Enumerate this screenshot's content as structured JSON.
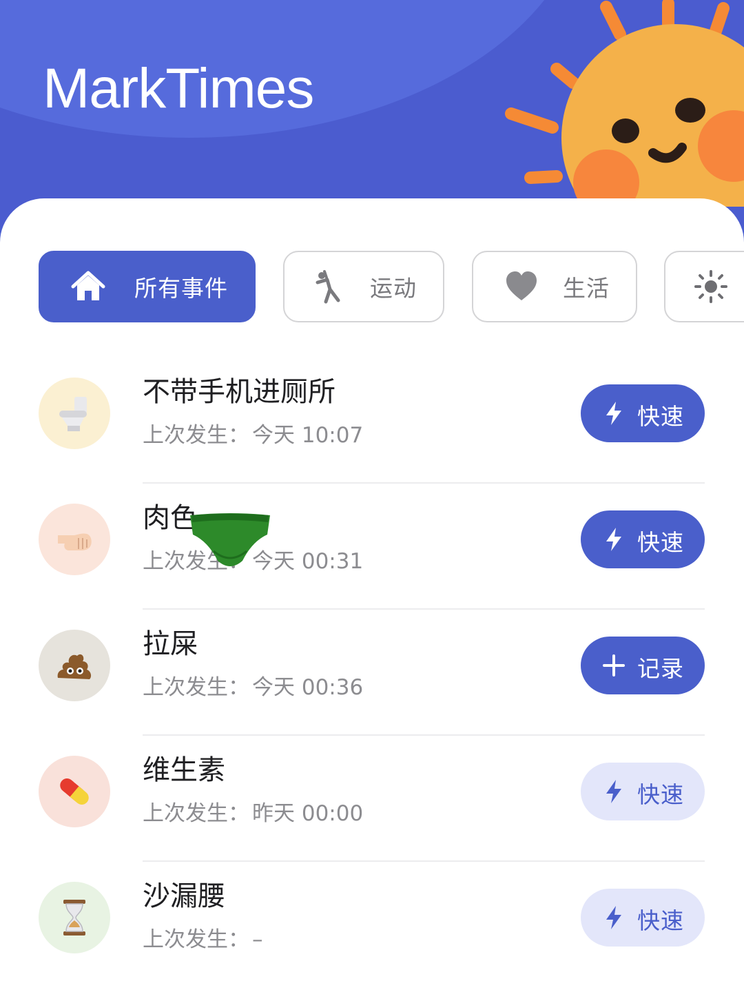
{
  "app": {
    "title": "MarkTimes"
  },
  "colors": {
    "primary": "#4a5fcb",
    "header": "#4b5ccf",
    "button_light": "#e3e6fa",
    "text": "#1f1f22",
    "subtext": "#8c8c90"
  },
  "tabs": [
    {
      "label": "所有事件",
      "icon": "home-icon",
      "active": true
    },
    {
      "label": "运动",
      "icon": "stretch-icon",
      "active": false
    },
    {
      "label": "生活",
      "icon": "heart-icon",
      "active": false
    },
    {
      "label": "",
      "icon": "sun-icon",
      "active": false
    }
  ],
  "events": [
    {
      "title": "不带手机进厕所",
      "sub_label": "上次发生：",
      "sub_value": "今天 10:07",
      "icon": "toilet-icon",
      "action": {
        "label": "快速",
        "icon": "lightning-icon",
        "style": "solid"
      }
    },
    {
      "title": "肉色",
      "sub_label": "上次发生：",
      "sub_value": "今天 00:31",
      "icon": "fist-icon",
      "action": {
        "label": "快速",
        "icon": "lightning-icon",
        "style": "solid"
      }
    },
    {
      "title": "拉屎",
      "sub_label": "上次发生：",
      "sub_value": "今天 00:36",
      "icon": "poop-icon",
      "action": {
        "label": "记录",
        "icon": "plus-icon",
        "style": "solid"
      }
    },
    {
      "title": "维生素",
      "sub_label": "上次发生：",
      "sub_value": "昨天 00:00",
      "icon": "pill-icon",
      "action": {
        "label": "快速",
        "icon": "lightning-icon",
        "style": "light"
      }
    },
    {
      "title": "沙漏腰",
      "sub_label": "上次发生：",
      "sub_value": "–",
      "icon": "hourglass-icon",
      "action": {
        "label": "快速",
        "icon": "lightning-icon",
        "style": "light"
      }
    }
  ]
}
